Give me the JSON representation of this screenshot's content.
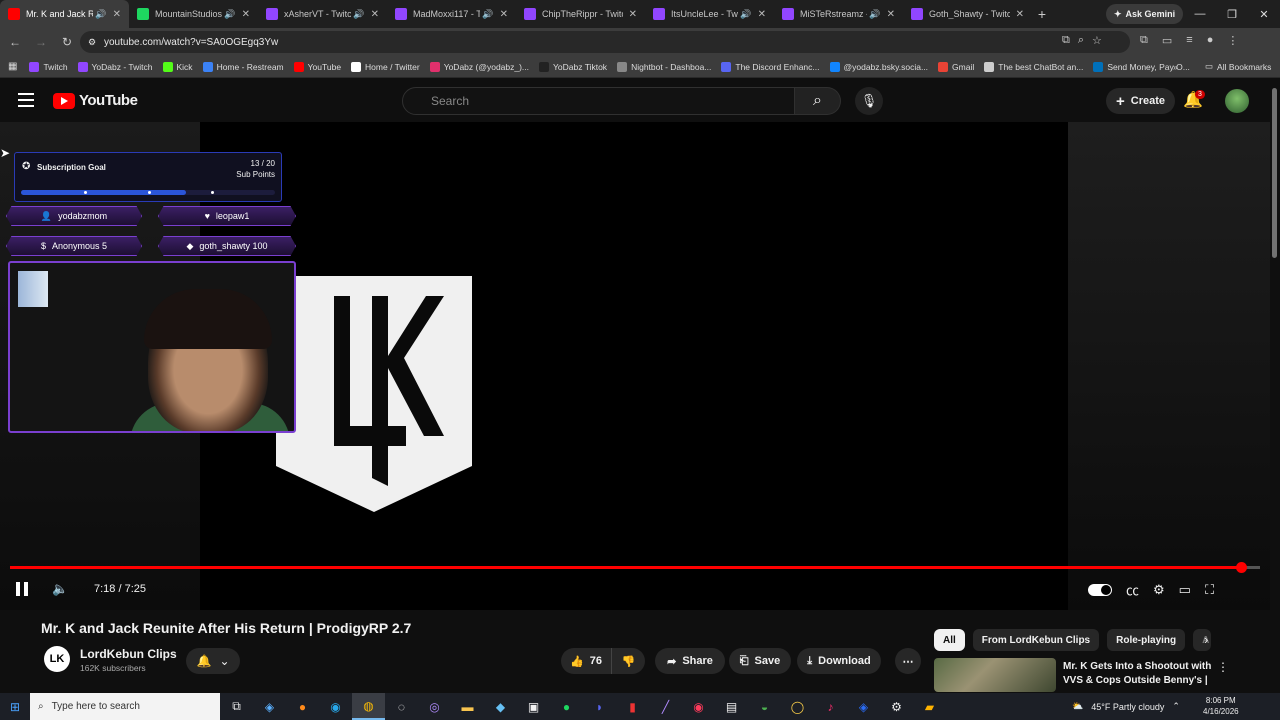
{
  "browser": {
    "tabs": [
      {
        "title": "Mr. K and Jack Reuni",
        "color": "#ff0000",
        "audio": true,
        "active": true
      },
      {
        "title": "MountainStudios S",
        "color": "#1ed760",
        "audio": true
      },
      {
        "title": "xAsherVT - Twitch",
        "color": "#9146ff",
        "audio": true
      },
      {
        "title": "MadMoxxi117 - Tw",
        "color": "#9146ff",
        "audio": true
      },
      {
        "title": "ChipTheRippr - Twitch",
        "color": "#9146ff"
      },
      {
        "title": "ItsUncleLee - Twitc",
        "color": "#9146ff",
        "audio": true
      },
      {
        "title": "MiSTeRstreamz - Tw",
        "color": "#9146ff",
        "audio": true
      },
      {
        "title": "Goth_Shawty - Twitch",
        "color": "#9146ff"
      }
    ],
    "ask_gemini": "Ask Gemini",
    "url": "youtube.com/watch?v=SA0OGEgq3Yw",
    "bookmarks": [
      {
        "label": "Twitch",
        "color": "#9146ff"
      },
      {
        "label": "YoDabz - Twitch",
        "color": "#9146ff"
      },
      {
        "label": "Kick",
        "color": "#53fc18"
      },
      {
        "label": "Home - Restream",
        "color": "#3b82f6"
      },
      {
        "label": "YouTube",
        "color": "#ff0000"
      },
      {
        "label": "Home / Twitter",
        "color": "#ffffff"
      },
      {
        "label": "YoDabz (@yodabz_)...",
        "color": "#e1306c"
      },
      {
        "label": "YoDabz Tiktok",
        "color": "#222222"
      },
      {
        "label": "Nightbot - Dashboa...",
        "color": "#888888"
      },
      {
        "label": "The Discord Enhanc...",
        "color": "#5865f2"
      },
      {
        "label": "@yodabz.bsky.socia...",
        "color": "#1185fe"
      },
      {
        "label": "Gmail",
        "color": "#ea4335"
      },
      {
        "label": "The best ChatBot an...",
        "color": "#cccccc"
      },
      {
        "label": "Send Money, Pay O...",
        "color": "#0070ba"
      }
    ],
    "all_bookmarks": "All Bookmarks"
  },
  "youtube": {
    "logo_text": "YouTube",
    "search_placeholder": "Search",
    "create_label": "Create",
    "notification_count": "3"
  },
  "overlay": {
    "subgoal_title": "Subscription Goal",
    "subgoal_count": "13 / 20",
    "subgoal_unit": "Sub Points",
    "subgoal_progress": 0.65,
    "pills": [
      {
        "label": "yodabzmom",
        "icon": "follower"
      },
      {
        "label": "leopaw1",
        "icon": "heart"
      },
      {
        "label": "Anonymous 5",
        "icon": "dollar"
      },
      {
        "label": "goth_shawty 100",
        "icon": "gem"
      }
    ]
  },
  "player": {
    "time": "7:18 / 7:25",
    "progress": 0.985
  },
  "video": {
    "title": "Mr. K and Jack Reunite After His Return | ProdigyRP 2.7",
    "channel": "LordKebun Clips",
    "subscribers": "162K subscribers",
    "likes": "76",
    "share": "Share",
    "save": "Save",
    "download": "Download"
  },
  "recommendations": {
    "chips": [
      "All",
      "From LordKebun Clips",
      "Role-playing",
      "A"
    ],
    "first_title": "Mr. K Gets Into a Shootout with VVS & Cops Outside Benny's | ..."
  },
  "taskbar": {
    "search_placeholder": "Type here to search",
    "weather": "45°F  Partly cloudy",
    "time": "8:06 PM",
    "date": "4/16/2026"
  }
}
